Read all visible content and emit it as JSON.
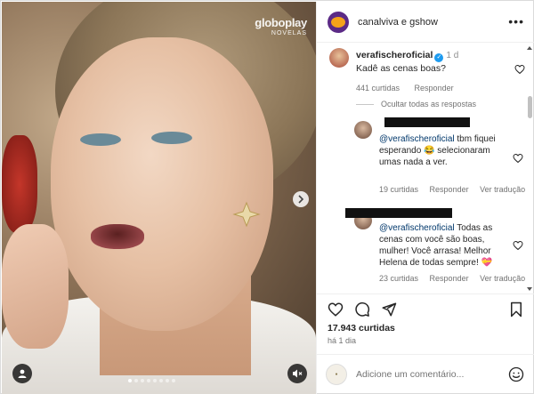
{
  "media": {
    "watermark_main": "globoplay",
    "watermark_sub": "NOVELAS",
    "carousel_dots": 8,
    "active_dot": 0
  },
  "header": {
    "account": "canalviva e gshow"
  },
  "main_comment": {
    "user": "verafischeroficial",
    "time": "1 d",
    "text": "Kadê as cenas boas?",
    "likes": "441 curtidas",
    "reply_label": "Responder"
  },
  "hide_replies": "Ocultar todas as respostas",
  "replies": [
    {
      "mention": "@verafischeroficial",
      "text": " tbm fiquei esperando 😂 selecionaram umas nada a ver.",
      "likes": "19 curtidas",
      "reply_label": "Responder",
      "translate_label": "Ver tradução"
    },
    {
      "mention": "@verafischeroficial",
      "text": " Todas as cenas com você são boas, mulher! Você arrasa! Melhor Helena de todas sempre! 💝",
      "likes": "23 curtidas",
      "reply_label": "Responder",
      "translate_label": "Ver tradução"
    }
  ],
  "post": {
    "likes": "17.943 curtidas",
    "posted": "há 1 dia"
  },
  "add_comment": {
    "placeholder": "Adicione um comentário..."
  },
  "colors": {
    "accent_blue": "#1d9bf0",
    "mention": "#00376b",
    "muted": "#737373"
  }
}
